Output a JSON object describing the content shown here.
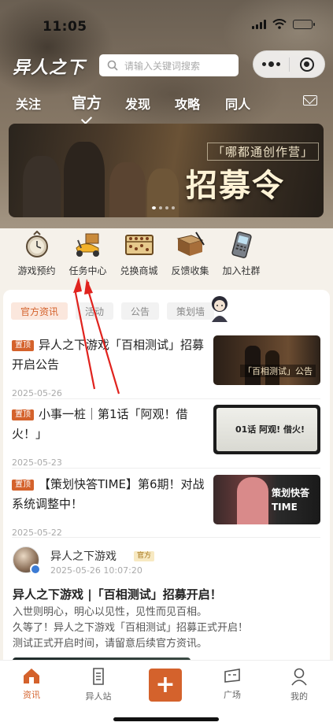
{
  "status_bar": {
    "time": "11:05"
  },
  "header": {
    "logo": "异人之下",
    "search_placeholder": "请输入关键词搜索",
    "nav_tabs": [
      {
        "label": "关注",
        "active": false
      },
      {
        "label": "官方",
        "active": true
      },
      {
        "label": "发现",
        "active": false
      },
      {
        "label": "攻略",
        "active": false
      },
      {
        "label": "同人",
        "active": false
      }
    ]
  },
  "banner": {
    "caption_small": "「哪都通创作营」",
    "caption_big": "招募令",
    "slide_count": 4,
    "active_slide": 0
  },
  "quick_entries": [
    {
      "label": "游戏预约",
      "icon": "pocket-watch-icon"
    },
    {
      "label": "任务中心",
      "icon": "scooter-icon"
    },
    {
      "label": "兑换商城",
      "icon": "abacus-icon"
    },
    {
      "label": "反馈收集",
      "icon": "book-pen-icon"
    },
    {
      "label": "加入社群",
      "icon": "phone-icon"
    }
  ],
  "sub_tabs": [
    {
      "label": "官方资讯",
      "active": true
    },
    {
      "label": "活动",
      "active": false
    },
    {
      "label": "公告",
      "active": false
    },
    {
      "label": "策划墙",
      "active": false
    }
  ],
  "news": [
    {
      "pin": "置顶",
      "title": "异人之下游戏「百相测试」招募开启公告",
      "date": "2025-05-26",
      "thumb_text": "「百相测试」公告"
    },
    {
      "pin": "置顶",
      "title": "小事一桩｜第1话「阿观！借火！」",
      "date": "2025-05-23",
      "thumb_text": "01话 阿观! 借火!"
    },
    {
      "pin": "置顶",
      "title": "【策划快答TIME】第6期！对战系统调整中！",
      "date": "2025-05-22",
      "thumb_text": "策划快答 TIME"
    }
  ],
  "post": {
    "author": "异人之下游戏",
    "badge": "官方",
    "time": "2025-05-26 10:07:20",
    "title": "异人之下游戏 |「百相测试」招募开启！",
    "body": [
      "入世则明心，明心以见性，见性而见百相。",
      "久等了！异人之下游戏「百相测试」招募正式开启！",
      "测试正式开启时间，请留意后续官方资讯。"
    ]
  },
  "tab_bar": [
    {
      "label": "资讯",
      "active": true
    },
    {
      "label": "异人站",
      "active": false
    },
    {
      "label": "+",
      "active": false
    },
    {
      "label": "广场",
      "active": false
    },
    {
      "label": "我的",
      "active": false
    }
  ],
  "colors": {
    "accent": "#d4622c",
    "annotation": "#e0231e"
  }
}
